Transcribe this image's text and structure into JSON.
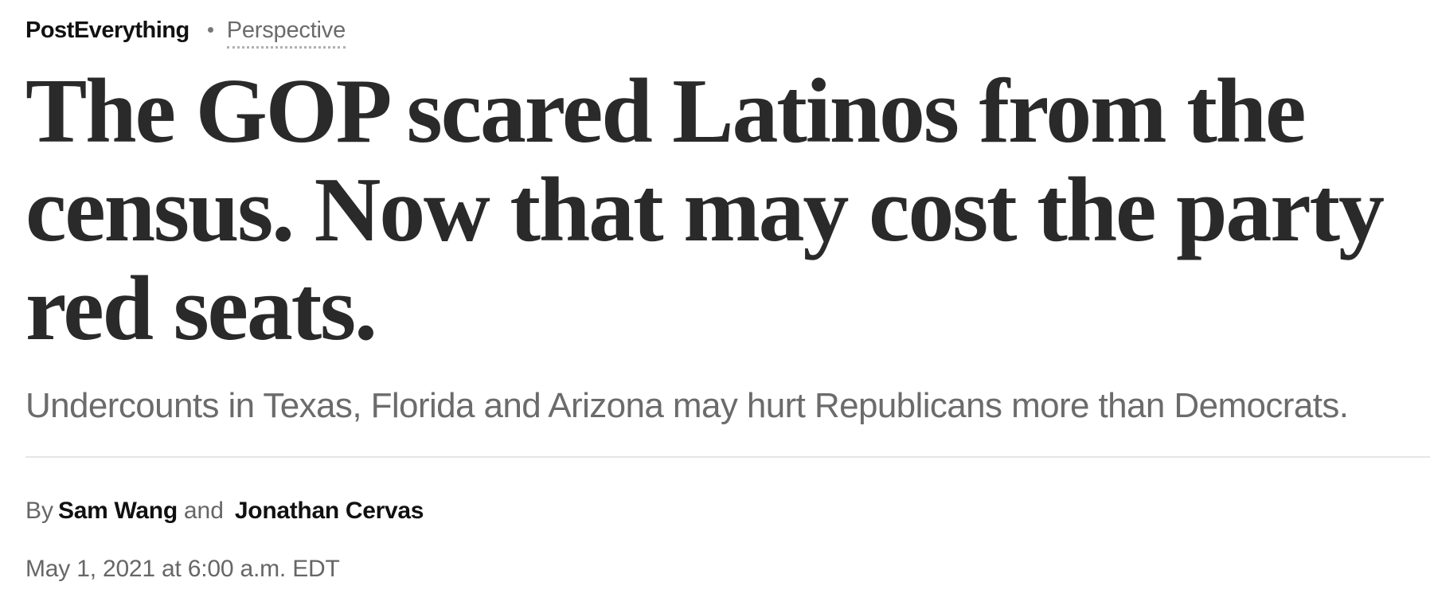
{
  "kicker": {
    "section": "PostEverything",
    "label": "Perspective"
  },
  "headline": "The GOP scared Latinos from the census. Now that may cost the party red seats.",
  "dek": "Undercounts in Texas, Florida and Arizona may hurt Republicans more than Democrats.",
  "byline": {
    "prefix": "By",
    "author_1": "Sam Wang",
    "conjunction": "and",
    "author_2": "Jonathan Cervas"
  },
  "timestamp": "May 1, 2021 at 6:00 a.m. EDT",
  "colors": {
    "headline": "#2a2a2a",
    "dek": "#6b6b6b",
    "divider": "#e6e6e6"
  }
}
